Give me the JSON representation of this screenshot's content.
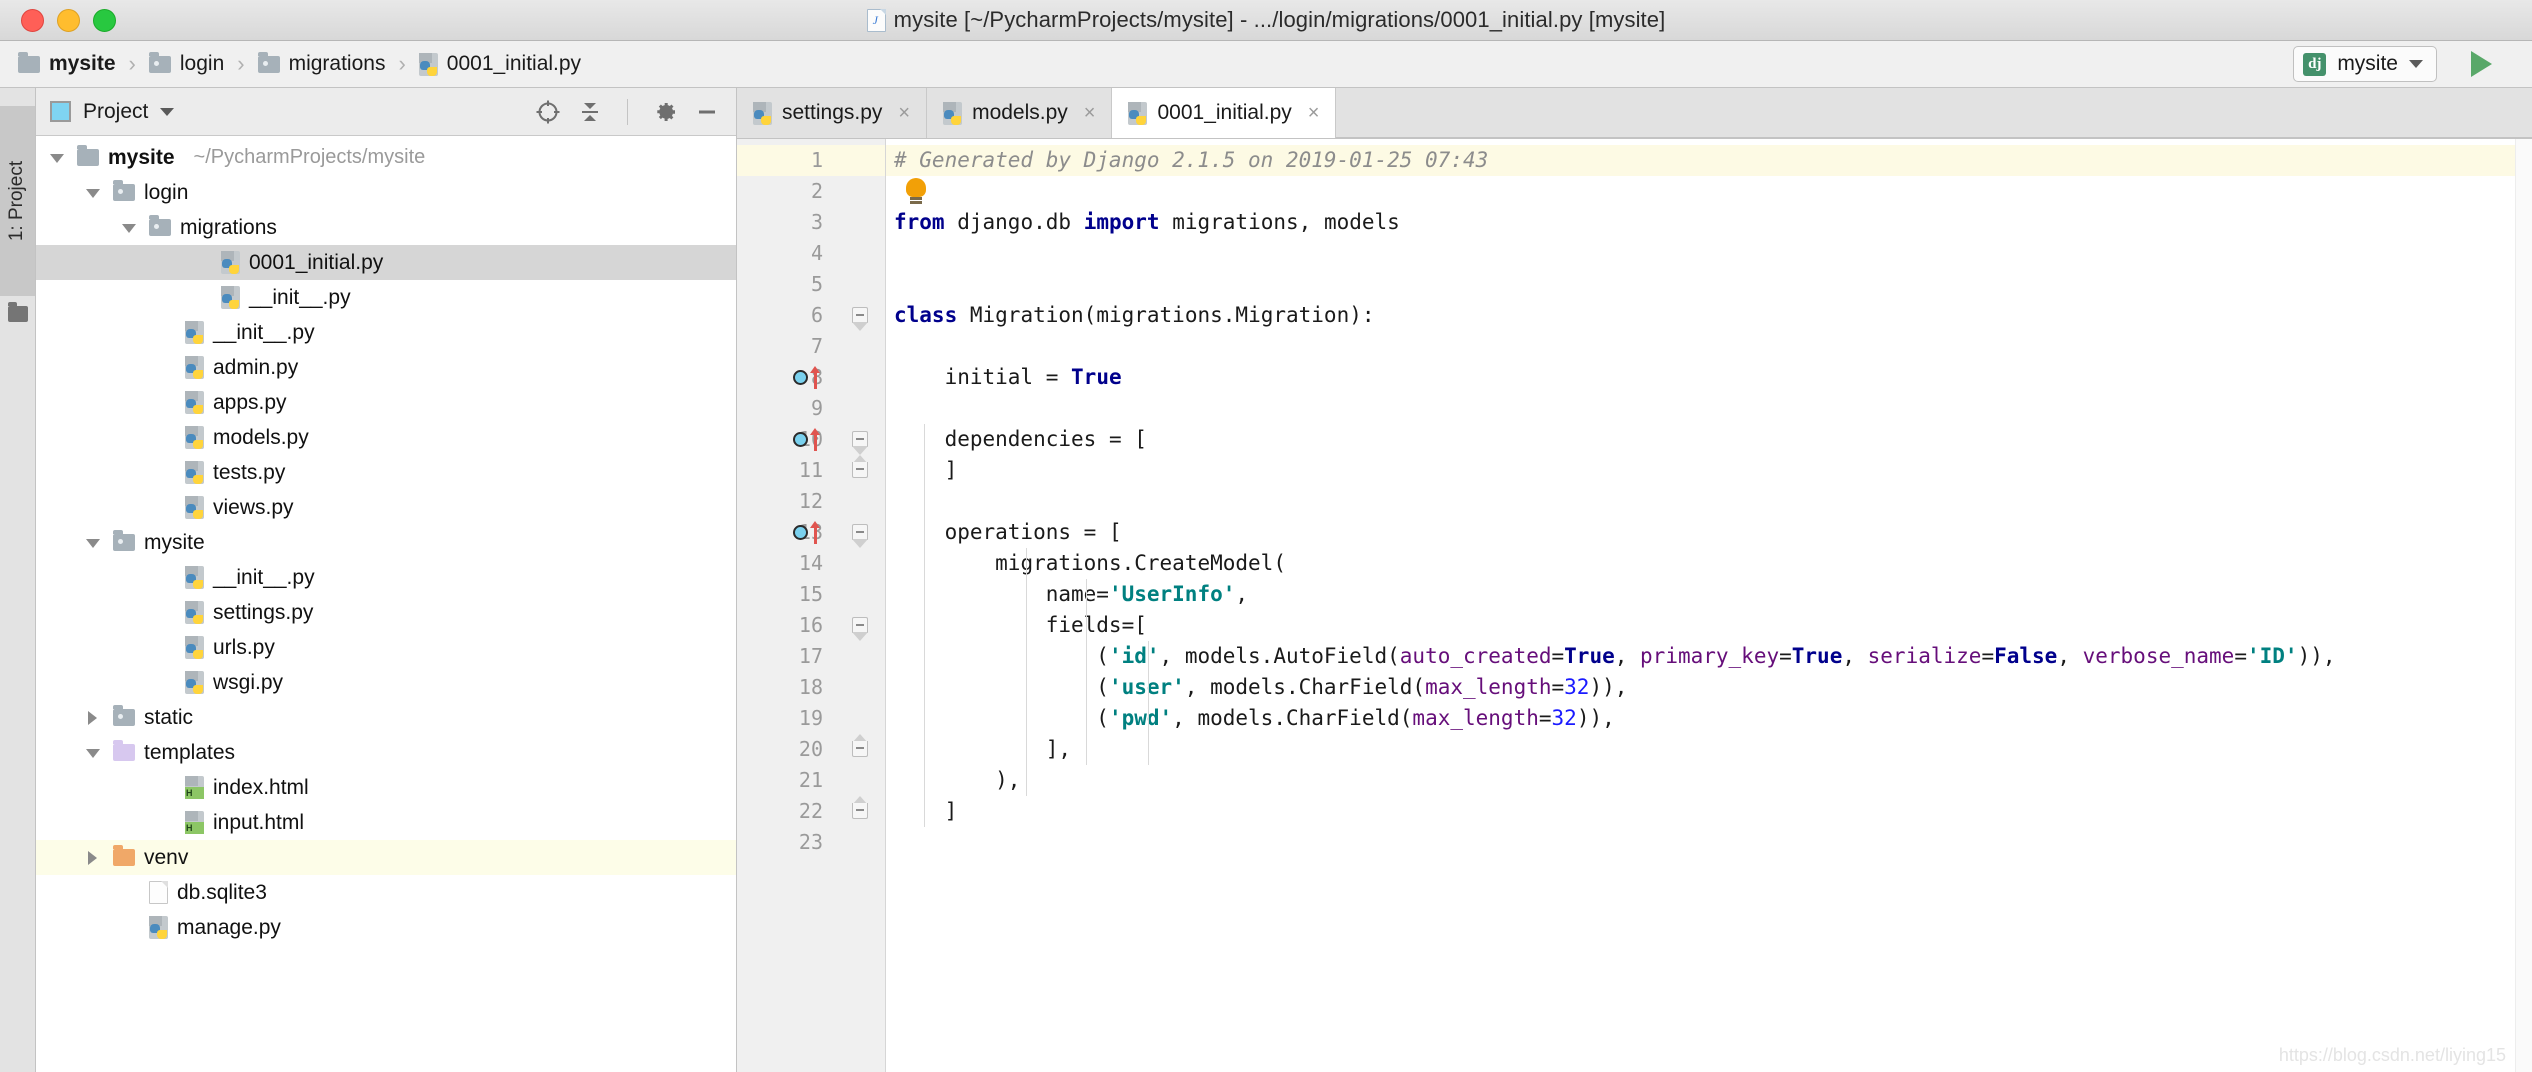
{
  "window": {
    "title": "mysite [~/PycharmProjects/mysite] - .../login/migrations/0001_initial.py [mysite]",
    "traffic": [
      "close",
      "minimize",
      "zoom"
    ]
  },
  "breadcrumb": {
    "separator": "›",
    "items": [
      {
        "label": "mysite",
        "icon": "folder-icon",
        "bold": true
      },
      {
        "label": "login",
        "icon": "folder-icon",
        "bold": false
      },
      {
        "label": "migrations",
        "icon": "folder-icon",
        "bold": false
      },
      {
        "label": "0001_initial.py",
        "icon": "python-file-icon",
        "bold": false
      }
    ]
  },
  "run_config": {
    "icon_label": "dj",
    "name": "mysite",
    "dropdown_icon": "chevron-down-icon",
    "run_icon": "run-play-icon"
  },
  "toolstrip": {
    "project_tab": "1: Project",
    "folder_icon": "folder-icon"
  },
  "project_panel": {
    "title": "Project",
    "dropdown_icon": "chevron-down-icon",
    "toolbar": [
      {
        "name": "locate-target-icon"
      },
      {
        "name": "collapse-all-icon"
      },
      {
        "name": "gear-icon"
      },
      {
        "name": "hide-panel-icon"
      }
    ],
    "tree": [
      {
        "label": "mysite",
        "suffix": "~/PycharmProjects/mysite",
        "icon": "folder-icon",
        "arrow": "down",
        "indent": 0,
        "bold": true,
        "state": "normal"
      },
      {
        "label": "login",
        "suffix": "",
        "icon": "folder-dot-icon",
        "arrow": "down",
        "indent": 1,
        "bold": false,
        "state": "normal"
      },
      {
        "label": "migrations",
        "suffix": "",
        "icon": "folder-dot-icon",
        "arrow": "down",
        "indent": 2,
        "bold": false,
        "state": "normal"
      },
      {
        "label": "0001_initial.py",
        "suffix": "",
        "icon": "python-file-icon",
        "arrow": "none",
        "indent": 4,
        "bold": false,
        "state": "selected"
      },
      {
        "label": "__init__.py",
        "suffix": "",
        "icon": "python-file-icon",
        "arrow": "none",
        "indent": 4,
        "bold": false,
        "state": "normal"
      },
      {
        "label": "__init__.py",
        "suffix": "",
        "icon": "python-file-icon",
        "arrow": "none",
        "indent": 3,
        "bold": false,
        "state": "normal"
      },
      {
        "label": "admin.py",
        "suffix": "",
        "icon": "python-file-icon",
        "arrow": "none",
        "indent": 3,
        "bold": false,
        "state": "normal"
      },
      {
        "label": "apps.py",
        "suffix": "",
        "icon": "python-file-icon",
        "arrow": "none",
        "indent": 3,
        "bold": false,
        "state": "normal"
      },
      {
        "label": "models.py",
        "suffix": "",
        "icon": "python-file-icon",
        "arrow": "none",
        "indent": 3,
        "bold": false,
        "state": "normal"
      },
      {
        "label": "tests.py",
        "suffix": "",
        "icon": "python-file-icon",
        "arrow": "none",
        "indent": 3,
        "bold": false,
        "state": "normal"
      },
      {
        "label": "views.py",
        "suffix": "",
        "icon": "python-file-icon",
        "arrow": "none",
        "indent": 3,
        "bold": false,
        "state": "normal"
      },
      {
        "label": "mysite",
        "suffix": "",
        "icon": "folder-dot-icon",
        "arrow": "down",
        "indent": 1,
        "bold": false,
        "state": "normal"
      },
      {
        "label": "__init__.py",
        "suffix": "",
        "icon": "python-file-icon",
        "arrow": "none",
        "indent": 3,
        "bold": false,
        "state": "normal"
      },
      {
        "label": "settings.py",
        "suffix": "",
        "icon": "python-file-icon",
        "arrow": "none",
        "indent": 3,
        "bold": false,
        "state": "normal"
      },
      {
        "label": "urls.py",
        "suffix": "",
        "icon": "python-file-icon",
        "arrow": "none",
        "indent": 3,
        "bold": false,
        "state": "normal"
      },
      {
        "label": "wsgi.py",
        "suffix": "",
        "icon": "python-file-icon",
        "arrow": "none",
        "indent": 3,
        "bold": false,
        "state": "normal"
      },
      {
        "label": "static",
        "suffix": "",
        "icon": "folder-dot-icon",
        "arrow": "right",
        "indent": 1,
        "bold": false,
        "state": "normal"
      },
      {
        "label": "templates",
        "suffix": "",
        "icon": "folder-purple-icon",
        "arrow": "down",
        "indent": 1,
        "bold": false,
        "state": "normal"
      },
      {
        "label": "index.html",
        "suffix": "",
        "icon": "html-file-icon",
        "arrow": "none",
        "indent": 3,
        "bold": false,
        "state": "normal"
      },
      {
        "label": "input.html",
        "suffix": "",
        "icon": "html-file-icon",
        "arrow": "none",
        "indent": 3,
        "bold": false,
        "state": "normal"
      },
      {
        "label": "venv",
        "suffix": "",
        "icon": "folder-orange-icon",
        "arrow": "right",
        "indent": 1,
        "bold": false,
        "state": "highlighted"
      },
      {
        "label": "db.sqlite3",
        "suffix": "",
        "icon": "generic-file-icon",
        "arrow": "none",
        "indent": 2,
        "bold": false,
        "state": "normal"
      },
      {
        "label": "manage.py",
        "suffix": "",
        "icon": "python-file-icon",
        "arrow": "none",
        "indent": 2,
        "bold": false,
        "state": "normal"
      }
    ]
  },
  "editor": {
    "tabs": [
      {
        "label": "settings.py",
        "icon": "python-file-icon",
        "active": false,
        "close_icon": "close-icon"
      },
      {
        "label": "models.py",
        "icon": "python-file-icon",
        "active": false,
        "close_icon": "close-icon"
      },
      {
        "label": "0001_initial.py",
        "icon": "python-file-icon",
        "active": true,
        "close_icon": "close-icon"
      }
    ],
    "first_line_highlighted": true,
    "intention_bulb": {
      "icon": "lightbulb-icon",
      "line": 2
    },
    "gutter_markers": [
      {
        "line": 8,
        "icons": [
          "class-field-marker-icon",
          "override-arrow-icon"
        ]
      },
      {
        "line": 10,
        "icons": [
          "class-field-marker-icon",
          "override-arrow-icon"
        ]
      },
      {
        "line": 13,
        "icons": [
          "class-field-marker-icon",
          "override-arrow-icon"
        ]
      }
    ],
    "fold_markers": [
      {
        "line": 6,
        "type": "start"
      },
      {
        "line": 10,
        "type": "start"
      },
      {
        "line": 11,
        "type": "end"
      },
      {
        "line": 13,
        "type": "start"
      },
      {
        "line": 16,
        "type": "start"
      },
      {
        "line": 20,
        "type": "end"
      },
      {
        "line": 22,
        "type": "end"
      }
    ],
    "line_numbers": [
      1,
      2,
      3,
      4,
      5,
      6,
      7,
      8,
      9,
      10,
      11,
      12,
      13,
      14,
      15,
      16,
      17,
      18,
      19,
      20,
      21,
      22,
      23
    ],
    "code_lines": [
      {
        "n": 1,
        "text": "# Generated by Django 2.1.5 on 2019-01-25 07:43"
      },
      {
        "n": 2,
        "text": ""
      },
      {
        "n": 3,
        "text": "from django.db import migrations, models"
      },
      {
        "n": 4,
        "text": ""
      },
      {
        "n": 5,
        "text": ""
      },
      {
        "n": 6,
        "text": "class Migration(migrations.Migration):"
      },
      {
        "n": 7,
        "text": ""
      },
      {
        "n": 8,
        "text": "    initial = True"
      },
      {
        "n": 9,
        "text": ""
      },
      {
        "n": 10,
        "text": "    dependencies = ["
      },
      {
        "n": 11,
        "text": "    ]"
      },
      {
        "n": 12,
        "text": ""
      },
      {
        "n": 13,
        "text": "    operations = ["
      },
      {
        "n": 14,
        "text": "        migrations.CreateModel("
      },
      {
        "n": 15,
        "text": "            name='UserInfo',"
      },
      {
        "n": 16,
        "text": "            fields=["
      },
      {
        "n": 17,
        "text": "                ('id', models.AutoField(auto_created=True, primary_key=True, serialize=False, verbose_name='ID')),"
      },
      {
        "n": 18,
        "text": "                ('user', models.CharField(max_length=32)),"
      },
      {
        "n": 19,
        "text": "                ('pwd', models.CharField(max_length=32)),"
      },
      {
        "n": 20,
        "text": "            ],"
      },
      {
        "n": 21,
        "text": "        ),"
      },
      {
        "n": 22,
        "text": "    ]"
      },
      {
        "n": 23,
        "text": ""
      }
    ],
    "watermark": "https://blog.csdn.net/liying15"
  },
  "colors": {
    "keyword": "#00008c",
    "string": "#008080",
    "number": "#1a1aff",
    "parameter": "#660e7a",
    "comment": "#8c8c8c",
    "selection": "#d6d6d6",
    "highlight_row": "#fdfde8",
    "django_green": "#44916b",
    "run_green": "#59a869"
  }
}
